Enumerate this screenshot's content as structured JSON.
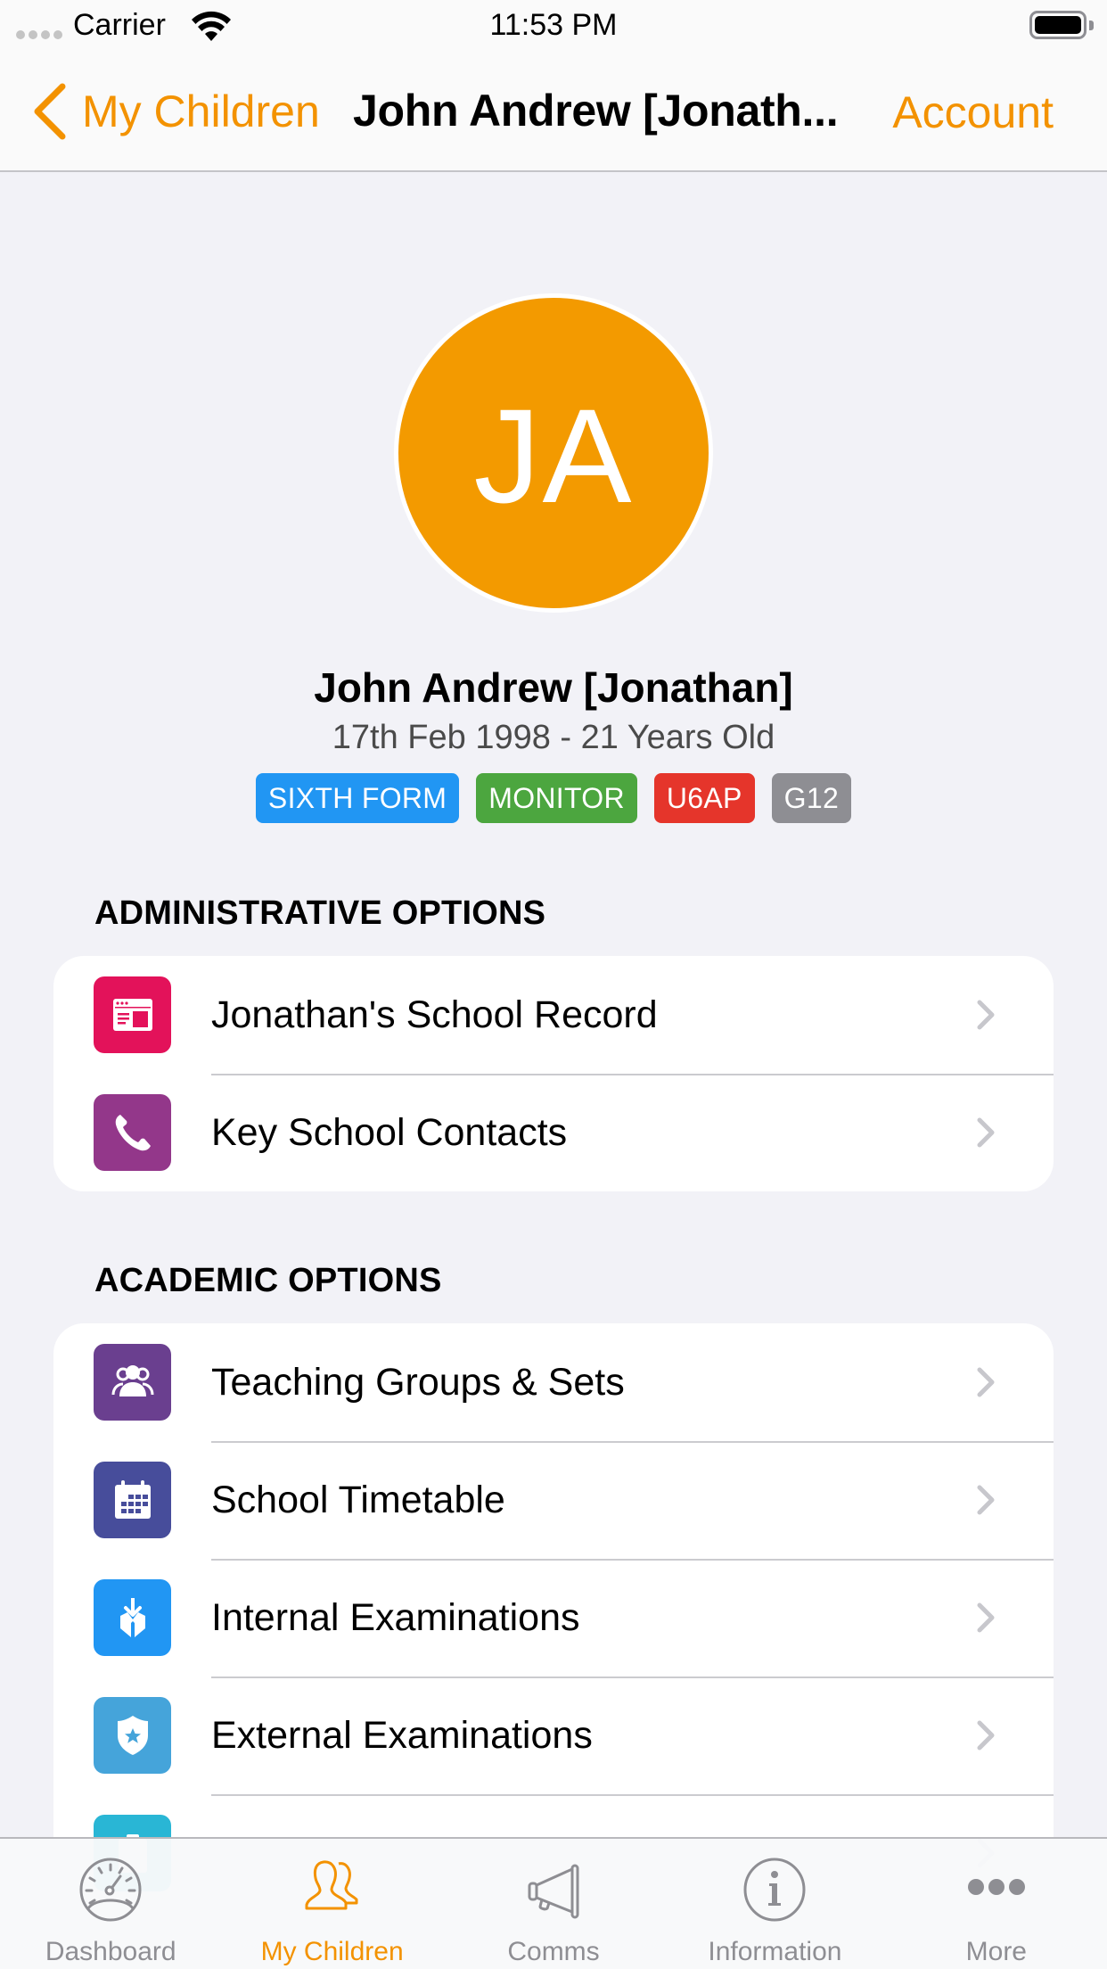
{
  "status_bar": {
    "carrier": "Carrier",
    "time": "11:53 PM",
    "battery_level": 1.0
  },
  "nav": {
    "back_label": "My Children",
    "title": "John Andrew [Jonath...",
    "account_label": "Account",
    "accent_color": "#F39200"
  },
  "profile": {
    "initials": "JA",
    "avatar_color": "#F39A00",
    "name": "John Andrew [Jonathan]",
    "dob_age": "17th Feb 1998 - 21 Years Old",
    "badges": [
      {
        "label": "SIXTH FORM",
        "color": "#2196F3"
      },
      {
        "label": "MONITOR",
        "color": "#4CA63F"
      },
      {
        "label": "U6AP",
        "color": "#E5352B"
      },
      {
        "label": "G12",
        "color": "#8E8E93"
      }
    ]
  },
  "sections": [
    {
      "title": "ADMINISTRATIVE OPTIONS",
      "items": [
        {
          "label": "Jonathan's School Record",
          "icon": "school-record-icon",
          "color": "#E3125A"
        },
        {
          "label": "Key School Contacts",
          "icon": "phone-icon",
          "color": "#93378A"
        }
      ]
    },
    {
      "title": "ACADEMIC OPTIONS",
      "items": [
        {
          "label": "Teaching Groups & Sets",
          "icon": "groups-icon",
          "color": "#6A3F8F"
        },
        {
          "label": "School Timetable",
          "icon": "calendar-icon",
          "color": "#474D9B"
        },
        {
          "label": "Internal Examinations",
          "icon": "box-download-icon",
          "color": "#2196F3"
        },
        {
          "label": "External Examinations",
          "icon": "shield-star-icon",
          "color": "#45A4DA"
        },
        {
          "label": "",
          "icon": "clipboard-icon",
          "color": "#29B6D5"
        }
      ]
    }
  ],
  "tab_bar": {
    "tabs": [
      {
        "label": "Dashboard",
        "icon": "dashboard-gauge-icon",
        "active": false
      },
      {
        "label": "My Children",
        "icon": "children-icon",
        "active": true
      },
      {
        "label": "Comms",
        "icon": "megaphone-icon",
        "active": false
      },
      {
        "label": "Information",
        "icon": "info-icon",
        "active": false
      },
      {
        "label": "More",
        "icon": "more-dots-icon",
        "active": false
      }
    ]
  }
}
